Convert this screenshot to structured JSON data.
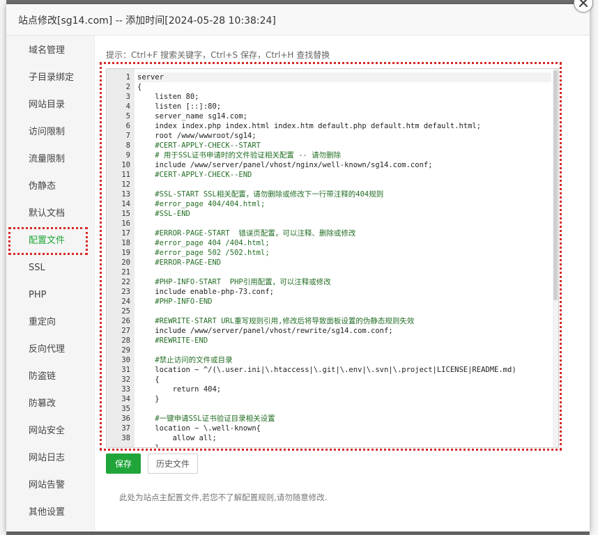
{
  "dialog": {
    "title": "站点修改[sg14.com] -- 添加时间[2024-05-28 10:38:24]"
  },
  "sidebar": {
    "items": [
      {
        "label": "域名管理"
      },
      {
        "label": "子目录绑定"
      },
      {
        "label": "网站目录"
      },
      {
        "label": "访问限制"
      },
      {
        "label": "流量限制"
      },
      {
        "label": "伪静态"
      },
      {
        "label": "默认文档"
      },
      {
        "label": "配置文件",
        "active": true
      },
      {
        "label": "SSL"
      },
      {
        "label": "PHP"
      },
      {
        "label": "重定向"
      },
      {
        "label": "反向代理"
      },
      {
        "label": "防盗链"
      },
      {
        "label": "防篡改"
      },
      {
        "label": "网站安全"
      },
      {
        "label": "网站日志"
      },
      {
        "label": "网站告警"
      },
      {
        "label": "其他设置"
      }
    ]
  },
  "hint": "提示：Ctrl+F 搜索关键字，Ctrl+S 保存，Ctrl+H 查找替换",
  "editor": {
    "lines": [
      "server",
      "{",
      "    listen 80;",
      "    listen [::]:80;",
      "    server_name sg14.com;",
      "    index index.php index.html index.htm default.php default.htm default.html;",
      "    root /www/wwwroot/sg14;",
      "    #CERT-APPLY-CHECK--START",
      "    # 用于SSL证书申请时的文件验证相关配置 -- 请勿删除",
      "    include /www/server/panel/vhost/nginx/well-known/sg14.com.conf;",
      "    #CERT-APPLY-CHECK--END",
      "",
      "    #SSL-START SSL相关配置，请勿删除或修改下一行带注释的404规则",
      "    #error_page 404/404.html;",
      "    #SSL-END",
      "",
      "    #ERROR-PAGE-START  错误页配置，可以注释、删除或修改",
      "    #error_page 404 /404.html;",
      "    #error_page 502 /502.html;",
      "    #ERROR-PAGE-END",
      "",
      "    #PHP-INFO-START  PHP引用配置，可以注释或修改",
      "    include enable-php-73.conf;",
      "    #PHP-INFO-END",
      "",
      "    #REWRITE-START URL重写规则引用,修改后将导致面板设置的伪静态规则失效",
      "    include /www/server/panel/vhost/rewrite/sg14.com.conf;",
      "    #REWRITE-END",
      "",
      "    #禁止访问的文件或目录",
      "    location ~ ^/(\\.user.ini|\\.htaccess|\\.git|\\.env|\\.svn|\\.project|LICENSE|README.md)",
      "    {",
      "        return 404;",
      "    }",
      "",
      "    #一键申请SSL证书验证目录相关设置",
      "    location ~ \\.well-known{",
      "        allow all;",
      "    }"
    ],
    "line_numbers": [
      "1",
      "2",
      "3",
      "4",
      "5",
      "6",
      "7",
      "8",
      "9",
      "10",
      "11",
      "12",
      "13",
      "14",
      "15",
      "16",
      "17",
      "18",
      "19",
      "20",
      "21",
      "22",
      "23",
      "24",
      "25",
      "26",
      "27",
      "28",
      "29",
      "30",
      "31",
      "32",
      "33",
      "34",
      "35",
      "36",
      "37",
      "38",
      ""
    ]
  },
  "buttons": {
    "save": "保存",
    "history": "历史文件"
  },
  "note": "此处为站点主配置文件,若您不了解配置规则,请勿随意修改.",
  "colors": {
    "accent": "#20a53a",
    "highlight_border": "#d62828",
    "comment": "#236e25",
    "keyword": "#1b3fa8"
  }
}
